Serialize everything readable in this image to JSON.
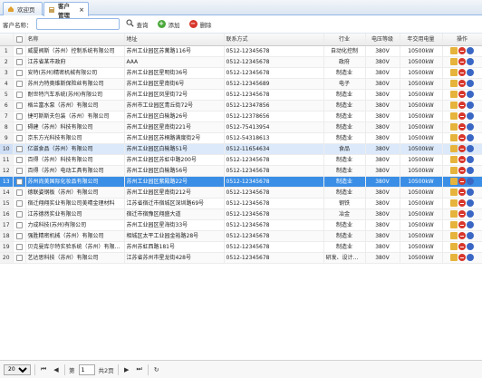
{
  "tabs": [
    {
      "label": "欢迎页",
      "icon": "home-icon"
    },
    {
      "label": "客户管理",
      "icon": "customer-icon",
      "close": "×"
    }
  ],
  "toolbar": {
    "name_label": "客户名称：",
    "search_value": "",
    "search_label": "查询",
    "add_label": "添加",
    "delete_label": "删除"
  },
  "columns": [
    "名称",
    "地址",
    "联系方式",
    "行业",
    "电压等级",
    "年交用电量",
    "操作"
  ],
  "rows": [
    {
      "n": "1",
      "name": "威厦阀斯（苏州）控制系统有限公司",
      "addr": "苏州工业园区苏蓠路116号",
      "tel": "0512-12345678",
      "ind": "自动化控制",
      "v": "380V",
      "kw": "10500kW"
    },
    {
      "n": "2",
      "name": "江苏省某市政府",
      "addr": "AAA",
      "tel": "0512-12345678",
      "ind": "政府",
      "v": "380V",
      "kw": "10500kW"
    },
    {
      "n": "3",
      "name": "安特(苏州)精密机械有限公司",
      "addr": "苏州工业园区星明街36号",
      "tel": "0512-12345678",
      "ind": "制造业",
      "v": "380V",
      "kw": "10500kW"
    },
    {
      "n": "4",
      "name": "苏州力特奥维斯保险丝有限公司",
      "addr": "苏州工业园区星南街6号",
      "tel": "0512-12345689",
      "ind": "电子",
      "v": "380V",
      "kw": "10500kW"
    },
    {
      "n": "5",
      "name": "耐世特汽车系统(苏州)有限公司",
      "addr": "苏州工业园区凤里街72号",
      "tel": "0512-12345678",
      "ind": "制造业",
      "v": "380V",
      "kw": "10500kW"
    },
    {
      "n": "6",
      "name": "格兰富水泵（苏州）有限公司",
      "addr": "苏州市工业园区青丘街72号",
      "tel": "0512-12347856",
      "ind": "制造业",
      "v": "380V",
      "kw": "10500kW"
    },
    {
      "n": "7",
      "name": "捷可斯斯夫包装（苏州）有限公司",
      "addr": "苏州工业园区白榆路26号",
      "tel": "0512-12378656",
      "ind": "制造业",
      "v": "380V",
      "kw": "10500kW"
    },
    {
      "n": "8",
      "name": "碍建（苏州）科技有限公司",
      "addr": "苏州工业园区星南街221号",
      "tel": "0512-75413954",
      "ind": "制造业",
      "v": "380V",
      "kw": "10500kW"
    },
    {
      "n": "9",
      "name": "京东方光科技有限公司",
      "addr": "苏州工业园区苏桐路满度街2号",
      "tel": "0512-54318613",
      "ind": "制造业",
      "v": "380V",
      "kw": "10500kW"
    },
    {
      "n": "10",
      "name": "亿滋食品（苏州）有限公司",
      "addr": "苏州工业园区白榆路51号",
      "tel": "0512-11654634",
      "ind": "食品",
      "v": "380V",
      "kw": "10500kW"
    },
    {
      "n": "11",
      "name": "百得（苏州）科技有限公司",
      "addr": "苏州工业园区苏虹中路200号",
      "tel": "0512-12345678",
      "ind": "制造业",
      "v": "380V",
      "kw": "10500kW"
    },
    {
      "n": "12",
      "name": "百得（苏州）电动工具有限公司",
      "addr": "苏州工业园区白榆路56号",
      "tel": "0512-12345678",
      "ind": "制造业",
      "v": "380V",
      "kw": "10500kW"
    },
    {
      "n": "13",
      "name": "苏州尚美国际化妆品有限公司",
      "addr": "苏州工业园区紫殿路22号",
      "tel": "0512-12345678",
      "ind": "制造业",
      "v": "380V",
      "kw": "10500kW"
    },
    {
      "n": "14",
      "name": "德联姿钢板（苏州）有限公司",
      "addr": "苏州工业园区星南街212号",
      "tel": "0512-12345678",
      "ind": "制造业",
      "v": "380V",
      "kw": "10500kW"
    },
    {
      "n": "15",
      "name": "宿迁翔翔实业有限公司美晴金理材料",
      "addr": "江苏省宿迁市宿城区深圳路69号",
      "tel": "0512-12345678",
      "ind": "钢铁",
      "v": "380V",
      "kw": "10500kW"
    },
    {
      "n": "16",
      "name": "江苏德然实业有限公司",
      "addr": "宿迁市宿豫区翔盛大道",
      "tel": "0512-12345678",
      "ind": "冶金",
      "v": "380V",
      "kw": "10500kW"
    },
    {
      "n": "17",
      "name": "力成科技(苏州)有限公司",
      "addr": "苏州工业园区星海街33号",
      "tel": "0512-12345678",
      "ind": "制造业",
      "v": "380V",
      "kw": "10500kW"
    },
    {
      "n": "18",
      "name": "强胜精密机械（苏州）有限公司",
      "addr": "相城区太平工业园金裕路28号",
      "tel": "0512-12345678",
      "ind": "制造业",
      "v": "380V",
      "kw": "10500kW"
    },
    {
      "n": "19",
      "name": "贝克曼库尔特实验系统（苏州）有限公司",
      "addr": "苏州苏虹西路181号",
      "tel": "0512-12345678",
      "ind": "制造业",
      "v": "380V",
      "kw": "10500kW"
    },
    {
      "n": "20",
      "name": "艺达思科技（苏州）有限公司",
      "addr": "江苏省苏州市星龙街428号",
      "tel": "0512-12345678",
      "ind": "研发、设计、制造",
      "v": "380V",
      "kw": "10500kW"
    }
  ],
  "pager": {
    "page_size": "20",
    "page_label": "第",
    "current_page": "1",
    "total_label": "共2页"
  },
  "colors": {
    "highlight_row": "#3a8ee6",
    "hover_row": "#dbe9fa",
    "border": "#95b8e7"
  }
}
